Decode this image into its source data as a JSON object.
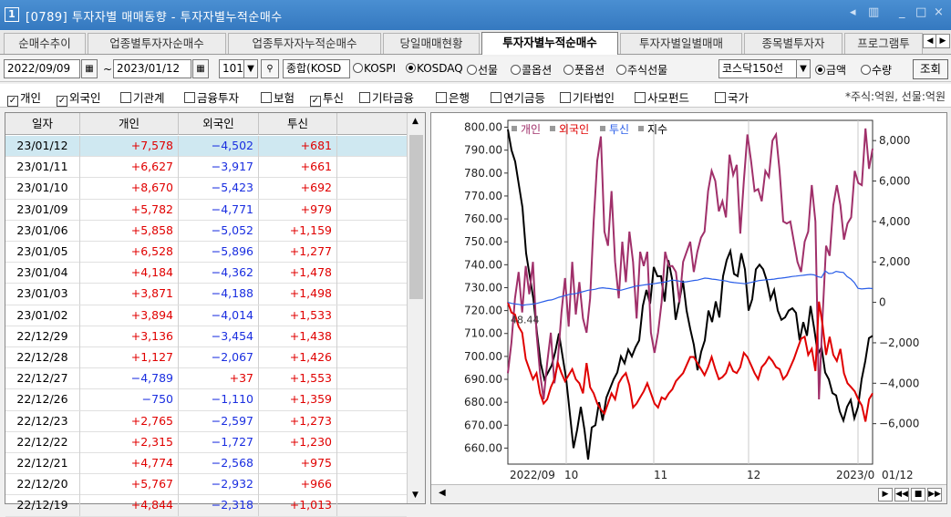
{
  "window": {
    "number": "1",
    "title": "[0789] 투자자별 매매동향 - 투자자별누적순매수",
    "controls": [
      "◂",
      "▥",
      "_",
      "□",
      "×"
    ]
  },
  "tabs": [
    {
      "label": "순매수추이",
      "active": false
    },
    {
      "label": "업종별투자자순매수",
      "active": false
    },
    {
      "label": "업종투자자누적순매수",
      "active": false
    },
    {
      "label": "당일매매현황",
      "active": false
    },
    {
      "label": "투자자별누적순매수",
      "active": true
    },
    {
      "label": "투자자별일별매매",
      "active": false
    },
    {
      "label": "종목별투자자",
      "active": false
    },
    {
      "label": "프로그램투",
      "active": false
    }
  ],
  "controls": {
    "start_date": "2022/09/09",
    "tilde": "~",
    "end_date": "2023/01/12",
    "count": "101",
    "market_select": "종합(KOSD",
    "market_radios": [
      {
        "label": "KOSPI",
        "checked": false
      },
      {
        "label": "KOSDAQ",
        "checked": true
      },
      {
        "label": "선물",
        "checked": false
      },
      {
        "label": "콜옵션",
        "checked": false
      },
      {
        "label": "풋옵션",
        "checked": false
      },
      {
        "label": "주식선물",
        "checked": false
      }
    ],
    "index_select": "코스닥150선",
    "unit_radios": [
      {
        "label": "금액",
        "checked": true
      },
      {
        "label": "수량",
        "checked": false
      }
    ],
    "lookup_button": "조회"
  },
  "investors": [
    {
      "label": "개인",
      "checked": true
    },
    {
      "label": "외국인",
      "checked": true
    },
    {
      "label": "기관계",
      "checked": false
    },
    {
      "label": "금융투자",
      "checked": false
    },
    {
      "label": "보험",
      "checked": false
    },
    {
      "label": "투신",
      "checked": true
    },
    {
      "label": "기타금융",
      "checked": false
    },
    {
      "label": "은행",
      "checked": false
    },
    {
      "label": "연기금등",
      "checked": false
    },
    {
      "label": "기타법인",
      "checked": false
    },
    {
      "label": "사모펀드",
      "checked": false
    },
    {
      "label": "국가",
      "checked": false
    }
  ],
  "unit_note": "*주식:억원, 선물:억원",
  "table": {
    "columns": [
      "일자",
      "개인",
      "외국인",
      "투신"
    ],
    "rows": [
      [
        "23/01/12",
        "+7,578",
        "−4,502",
        "+681"
      ],
      [
        "23/01/11",
        "+6,627",
        "−3,917",
        "+661"
      ],
      [
        "23/01/10",
        "+8,670",
        "−5,423",
        "+692"
      ],
      [
        "23/01/09",
        "+5,782",
        "−4,771",
        "+979"
      ],
      [
        "23/01/06",
        "+5,858",
        "−5,052",
        "+1,159"
      ],
      [
        "23/01/05",
        "+6,528",
        "−5,896",
        "+1,277"
      ],
      [
        "23/01/04",
        "+4,184",
        "−4,362",
        "+1,478"
      ],
      [
        "23/01/03",
        "+3,871",
        "−4,188",
        "+1,498"
      ],
      [
        "23/01/02",
        "+3,894",
        "−4,014",
        "+1,533"
      ],
      [
        "22/12/29",
        "+3,136",
        "−3,454",
        "+1,438"
      ],
      [
        "22/12/28",
        "+1,127",
        "−2,067",
        "+1,426"
      ],
      [
        "22/12/27",
        "−4,789",
        "+37",
        "+1,553"
      ],
      [
        "22/12/26",
        "−750",
        "−1,110",
        "+1,359"
      ],
      [
        "22/12/23",
        "+2,765",
        "−2,597",
        "+1,273"
      ],
      [
        "22/12/22",
        "+2,315",
        "−1,727",
        "+1,230"
      ],
      [
        "22/12/21",
        "+4,774",
        "−2,568",
        "+975"
      ],
      [
        "22/12/20",
        "+5,767",
        "−2,932",
        "+966"
      ],
      [
        "22/12/19",
        "+4,844",
        "−2,318",
        "+1,013"
      ]
    ]
  },
  "chart_data": {
    "type": "line",
    "legend": [
      {
        "name": "개인",
        "color": "#a0306a"
      },
      {
        "name": "외국인",
        "color": "#e00000"
      },
      {
        "name": "투신",
        "color": "#2a5ee8"
      },
      {
        "name": "지수",
        "color": "#000000"
      }
    ],
    "left_axis": {
      "ticks": [
        "800.00",
        "790.00",
        "780.00",
        "770.00",
        "760.00",
        "750.00",
        "740.00",
        "730.00",
        "720.00",
        "710.00",
        "700.00",
        "690.00",
        "680.00",
        "670.00",
        "660.00"
      ],
      "ylim": [
        653,
        803
      ]
    },
    "right_axis": {
      "ticks": [
        "8,000",
        "6,000",
        "4,000",
        "2,000",
        "0",
        "−2,000",
        "−4,000",
        "−6,000"
      ],
      "ylim": [
        -8000,
        9000
      ]
    },
    "x_labels": [
      "2022/09",
      "10",
      "11",
      "12",
      "2023/0",
      "01/12"
    ],
    "annotation": "48.44",
    "grid": true,
    "series": [
      {
        "name": "지수",
        "axis": "left",
        "color": "#000000",
        "values": [
          799,
          790,
          785,
          775,
          765,
          745,
          735,
          725,
          710,
          697,
          690,
          693,
          696,
          702,
          710,
          700,
          690,
          675,
          660,
          668,
          678,
          668,
          655,
          669,
          670,
          680,
          672,
          682,
          686,
          690,
          693,
          700,
          697,
          703,
          700,
          704,
          707,
          722,
          729,
          723,
          739,
          735,
          735,
          724,
          742,
          734,
          716,
          724,
          733,
          720,
          712,
          705,
          694,
          702,
          707,
          720,
          715,
          724,
          717,
          735,
          742,
          746,
          736,
          735,
          745,
          738,
          720,
          725,
          738,
          740,
          738,
          733,
          725,
          729,
          720,
          716,
          717,
          720,
          721,
          719,
          707,
          715,
          709,
          722,
          712,
          701,
          704,
          693,
          690,
          684,
          683,
          676,
          672,
          678,
          681,
          673,
          678,
          690,
          698,
          708,
          709
        ]
      },
      {
        "name": "개인",
        "axis": "right",
        "color": "#a0306a",
        "values": [
          -3500,
          -2000,
          200,
          1500,
          -500,
          1800,
          400,
          2000,
          -1500,
          -3500,
          -4800,
          -3000,
          -1500,
          -4000,
          -2800,
          -500,
          1200,
          -1200,
          2000,
          -600,
          1000,
          -800,
          -1500,
          200,
          4000,
          7000,
          8200,
          3500,
          2800,
          5500,
          2000,
          200,
          3000,
          1000,
          3500,
          2000,
          -800,
          2500,
          1800,
          2500,
          -1500,
          -2500,
          -1500,
          0,
          2500,
          1800,
          1800,
          1500,
          0,
          2000,
          2500,
          3000,
          1500,
          2500,
          3200,
          3500,
          5500,
          6500,
          6000,
          4500,
          5000,
          4200,
          7300,
          6300,
          6800,
          3400,
          6000,
          8300,
          7000,
          5500,
          5600,
          5000,
          6500,
          6200,
          8000,
          8300,
          6500,
          4000,
          3900,
          4000,
          3000,
          2000,
          1500,
          3000,
          3500,
          5800,
          4000,
          -4800,
          -750,
          2800,
          2300,
          4800,
          5800,
          4800,
          3100,
          3900,
          4200,
          6500,
          5900,
          5800,
          8600,
          6600,
          7600
        ]
      },
      {
        "name": "외국인",
        "axis": "right",
        "color": "#e00000",
        "values": [
          0,
          -500,
          -600,
          -1200,
          -1500,
          -2800,
          -3300,
          -3800,
          -3500,
          -4500,
          -5000,
          -4800,
          -4200,
          -3800,
          -3000,
          -3500,
          -3900,
          -3600,
          -3300,
          -3800,
          -4000,
          -4500,
          -3000,
          -4200,
          -4500,
          -5000,
          -5300,
          -5500,
          -5000,
          -4500,
          -4800,
          -4000,
          -3700,
          -3500,
          -4100,
          -5200,
          -5000,
          -4700,
          -4400,
          -4000,
          -4500,
          -5000,
          -5200,
          -4700,
          -4800,
          -4500,
          -4300,
          -3900,
          -3700,
          -3500,
          -3100,
          -2700,
          -2700,
          -3000,
          -3300,
          -3600,
          -3200,
          -2700,
          -3300,
          -3800,
          -3700,
          -3500,
          -3000,
          -3400,
          -3500,
          -3200,
          -2500,
          -2700,
          -3100,
          -3500,
          -3800,
          -3200,
          -3000,
          -2700,
          -2900,
          -3200,
          -3300,
          -3800,
          -3600,
          -3200,
          -2800,
          -2300,
          -1800,
          -1700,
          -2600,
          -2300,
          -3400,
          37,
          -1100,
          -2600,
          -1700,
          -2600,
          -2900,
          -2300,
          -3500,
          -4000,
          -4200,
          -4400,
          -4800,
          -5100,
          -5900,
          -4800,
          -4500
        ]
      },
      {
        "name": "투신",
        "axis": "right",
        "color": "#2a5ee8",
        "values": [
          0,
          -50,
          -80,
          -100,
          -150,
          -120,
          -100,
          -80,
          -50,
          0,
          50,
          100,
          120,
          180,
          250,
          300,
          350,
          400,
          420,
          450,
          500,
          550,
          600,
          620,
          650,
          700,
          720,
          700,
          680,
          650,
          620,
          600,
          650,
          700,
          750,
          800,
          820,
          850,
          880,
          900,
          920,
          950,
          980,
          1000,
          1050,
          1100,
          1080,
          1050,
          1000,
          1020,
          1050,
          1080,
          1100,
          1150,
          1200,
          1180,
          1150,
          1130,
          1100,
          1080,
          1050,
          1000,
          980,
          960,
          940,
          920,
          960,
          1000,
          1040,
          1080,
          1100,
          1120,
          1130,
          1150,
          1180,
          1200,
          1220,
          1250,
          1280,
          1300,
          1320,
          1340,
          1360,
          1380,
          1359,
          1273,
          1230,
          1553,
          1426,
          1438,
          1533,
          1498,
          1478,
          1277,
          1159,
          979,
          692,
          661,
          681,
          700,
          680
        ]
      }
    ]
  }
}
